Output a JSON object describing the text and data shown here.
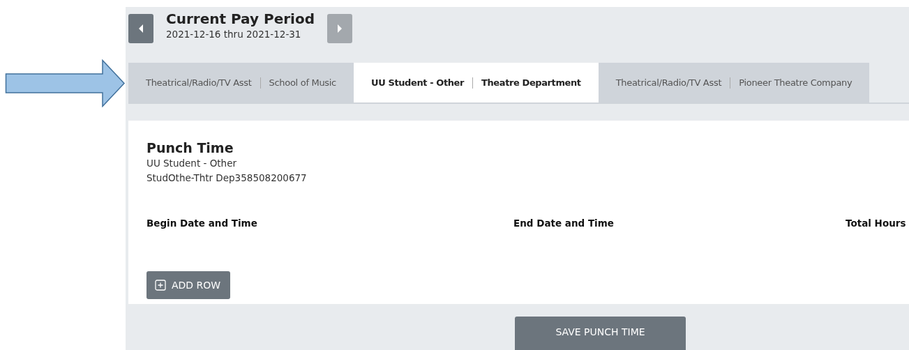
{
  "pay_period": {
    "title": "Current Pay Period",
    "range": "2021-12-16 thru 2021-12-31",
    "prev_disabled": false,
    "next_disabled": true
  },
  "tabs": [
    {
      "job": "Theatrical/Radio/TV Asst",
      "department": "School of Music",
      "selected": false
    },
    {
      "job": "UU Student - Other",
      "department": "Theatre Department",
      "selected": true
    },
    {
      "job": "Theatrical/Radio/TV Asst",
      "department": "Pioneer Theatre Company",
      "selected": false
    }
  ],
  "punch_time": {
    "title": "Punch Time",
    "job": "UU Student - Other",
    "position": "StudOthe-Thtr Dep358508200677",
    "columns": [
      "Begin Date and Time",
      "End Date and Time",
      "Total Hours"
    ],
    "add_row": "ADD ROW"
  },
  "save_button": "SAVE PUNCH TIME"
}
